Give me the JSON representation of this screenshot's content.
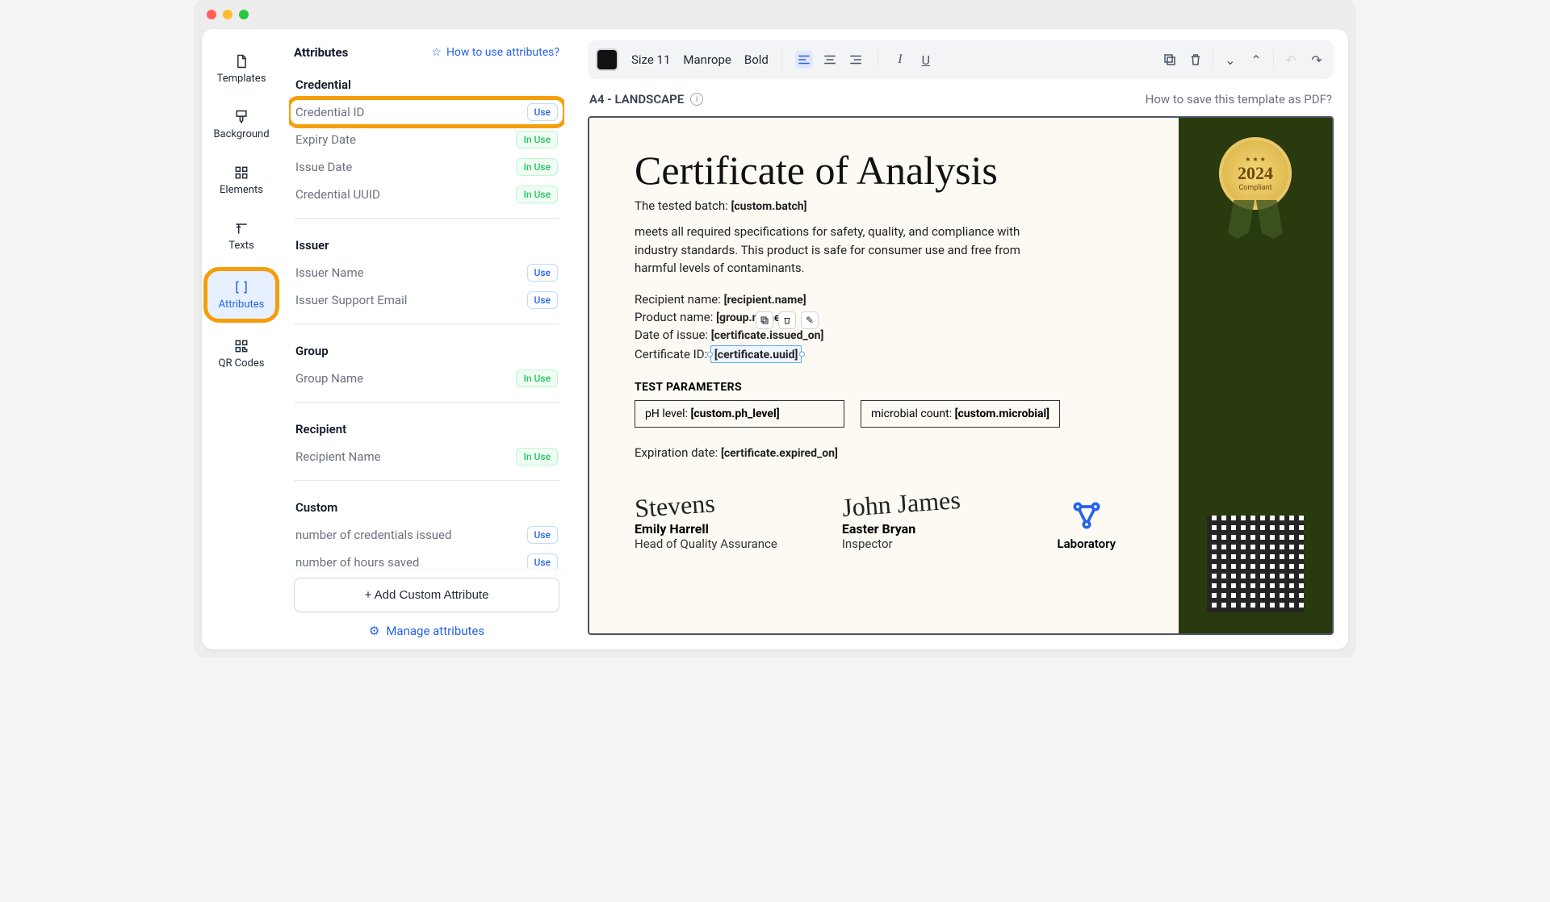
{
  "leftnav": {
    "templates": "Templates",
    "background": "Background",
    "elements": "Elements",
    "texts": "Texts",
    "attributes": "Attributes",
    "qrcodes": "QR Codes"
  },
  "panel": {
    "title": "Attributes",
    "help_link": "How to use attributes?",
    "sections": {
      "credential": {
        "title": "Credential",
        "items": [
          {
            "name": "Credential ID",
            "status": "Use",
            "highlight": true
          },
          {
            "name": "Expiry Date",
            "status": "In Use"
          },
          {
            "name": "Issue Date",
            "status": "In Use"
          },
          {
            "name": "Credential UUID",
            "status": "In Use"
          }
        ]
      },
      "issuer": {
        "title": "Issuer",
        "items": [
          {
            "name": "Issuer Name",
            "status": "Use"
          },
          {
            "name": "Issuer Support Email",
            "status": "Use"
          }
        ]
      },
      "group": {
        "title": "Group",
        "items": [
          {
            "name": "Group Name",
            "status": "In Use"
          }
        ]
      },
      "recipient": {
        "title": "Recipient",
        "items": [
          {
            "name": "Recipient Name",
            "status": "In Use"
          }
        ]
      },
      "custom": {
        "title": "Custom",
        "items": [
          {
            "name": "number of credentials issued",
            "status": "Use"
          },
          {
            "name": "number of hours saved",
            "status": "Use"
          }
        ]
      }
    },
    "add_button": "+  Add Custom Attribute",
    "manage_link": "Manage attributes"
  },
  "toolbar": {
    "size": "Size 11",
    "font": "Manrope",
    "weight": "Bold"
  },
  "canvas": {
    "format": "A4 - LANDSCAPE",
    "help": "How to save this template as PDF?"
  },
  "cert": {
    "title": "Certificate of Analysis",
    "batch_label": "The tested batch:",
    "batch_token": "[custom.batch]",
    "body": "meets all required specifications for safety, quality, and compliance with industry standards. This product is safe for consumer use and free from harmful levels of contaminants.",
    "recipient_label": "Recipient name:",
    "recipient_token": "[recipient.name]",
    "product_label": "Product name:",
    "product_token": "[group.name]",
    "issue_label": "Date of issue:",
    "issue_token": "[certificate.issued_on]",
    "id_label": "Certificate ID:",
    "id_token": "[certificate.uuid]",
    "test_params_header": "TEST PARAMETERS",
    "ph_label": "pH level:",
    "ph_token": "[custom.ph_level]",
    "microbial_label": "microbial count:",
    "microbial_token": "[custom.microbial]",
    "exp_label": "Expiration date:",
    "exp_token": "[certificate.expired_on]",
    "sig1_name": "Emily Harrell",
    "sig1_role": "Head of Quality Assurance",
    "sig2_name": "Easter Bryan",
    "sig2_role": "Inspector",
    "lab_label": "Laboratory",
    "medal_year": "2024",
    "medal_sub": "Compliant"
  }
}
